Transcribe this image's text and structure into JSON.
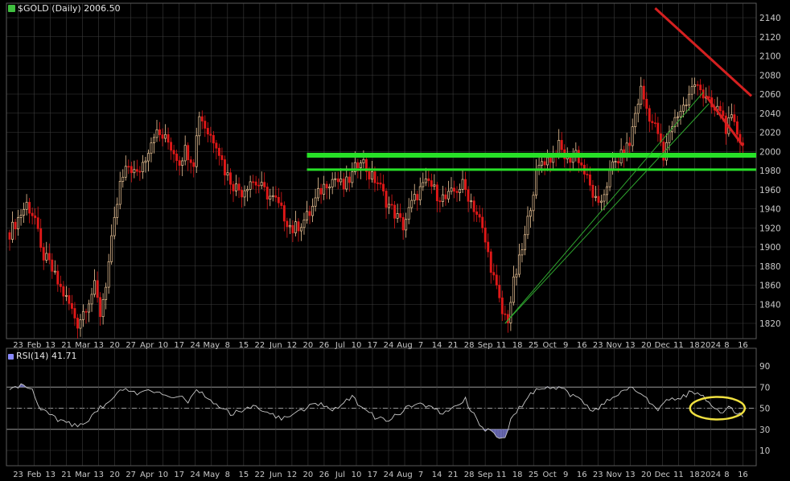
{
  "colors": {
    "background": "#000000",
    "grid": "#3c3c3c",
    "axis_text": "#c8c8c8",
    "candle_up": "#f0c89a",
    "candle_down": "#e01818",
    "support_line": "#27e027",
    "trendline": "#2fa82f",
    "resistance_line": "#d42020",
    "rsi_line": "#c8c8c8",
    "rsi_fill": "#8080d8",
    "highlight_ellipse": "#f0e040"
  },
  "price_panel": {
    "header_icon": "gold-chart-icon",
    "header": "$GOLD (Daily) 2006.50"
  },
  "rsi_panel": {
    "header_icon": "rsi-indicator-icon",
    "header": "RSI(14) 41.71"
  },
  "chart_data": [
    {
      "type": "candlestick",
      "title": "$GOLD (Daily) 2006.50",
      "ylim": [
        1805,
        2160
      ],
      "y_ticks": [
        1820,
        1840,
        1860,
        1880,
        1900,
        1920,
        1940,
        1960,
        1980,
        2000,
        2020,
        2040,
        2060,
        2080,
        2100,
        2120,
        2140
      ],
      "x_tick_labels": [
        "23",
        "Feb",
        "13",
        "21",
        "Mar",
        "13",
        "20",
        "27",
        "Apr",
        "10",
        "17",
        "24",
        "May",
        "8",
        "15",
        "22",
        "Jun",
        "12",
        "20",
        "26",
        "Jul",
        "10",
        "17",
        "24",
        "Aug",
        "7",
        "14",
        "21",
        "28",
        "Sep",
        "11",
        "18",
        "25",
        "Oct",
        "9",
        "16",
        "23",
        "Nov",
        "13",
        "20",
        "Dec",
        "11",
        "18",
        "2024",
        "8",
        "16"
      ],
      "grid": true,
      "price_path": [
        [
          0,
          1915
        ],
        [
          3,
          1930
        ],
        [
          6,
          1945
        ],
        [
          9,
          1930
        ],
        [
          11,
          1895
        ],
        [
          14,
          1882
        ],
        [
          17,
          1862
        ],
        [
          21,
          1840
        ],
        [
          24,
          1820
        ],
        [
          28,
          1845
        ],
        [
          30,
          1858
        ],
        [
          32,
          1830
        ],
        [
          34,
          1862
        ],
        [
          36,
          1905
        ],
        [
          39,
          1965
        ],
        [
          42,
          1985
        ],
        [
          45,
          1975
        ],
        [
          48,
          1995
        ],
        [
          51,
          2020
        ],
        [
          54,
          2015
        ],
        [
          56,
          2010
        ],
        [
          58,
          2000
        ],
        [
          60,
          1990
        ],
        [
          62,
          2002
        ],
        [
          65,
          1990
        ],
        [
          67,
          2040
        ],
        [
          70,
          2020
        ],
        [
          73,
          2010
        ],
        [
          76,
          1980
        ],
        [
          79,
          1965
        ],
        [
          82,
          1958
        ],
        [
          85,
          1970
        ],
        [
          88,
          1965
        ],
        [
          91,
          1955
        ],
        [
          94,
          1948
        ],
        [
          97,
          1932
        ],
        [
          100,
          1918
        ],
        [
          103,
          1925
        ],
        [
          106,
          1935
        ],
        [
          109,
          1955
        ],
        [
          112,
          1968
        ],
        [
          115,
          1972
        ],
        [
          118,
          1962
        ],
        [
          121,
          1975
        ],
        [
          124,
          1995
        ],
        [
          127,
          1975
        ],
        [
          130,
          1968
        ],
        [
          133,
          1948
        ],
        [
          136,
          1935
        ],
        [
          139,
          1922
        ],
        [
          142,
          1945
        ],
        [
          145,
          1960
        ],
        [
          148,
          1968
        ],
        [
          151,
          1955
        ],
        [
          154,
          1950
        ],
        [
          157,
          1958
        ],
        [
          160,
          1965
        ],
        [
          163,
          1948
        ],
        [
          166,
          1928
        ],
        [
          168,
          1905
        ],
        [
          170,
          1880
        ],
        [
          172,
          1855
        ],
        [
          174,
          1830
        ],
        [
          176,
          1825
        ],
        [
          178,
          1862
        ],
        [
          180,
          1885
        ],
        [
          182,
          1910
        ],
        [
          184,
          1945
        ],
        [
          186,
          1975
        ],
        [
          188,
          1990
        ],
        [
          191,
          1993
        ],
        [
          194,
          2005
        ],
        [
          197,
          1990
        ],
        [
          200,
          2000
        ],
        [
          203,
          1978
        ],
        [
          206,
          1955
        ],
        [
          208,
          1940
        ],
        [
          210,
          1958
        ],
        [
          213,
          1985
        ],
        [
          216,
          1995
        ],
        [
          219,
          2008
        ],
        [
          221,
          2040
        ],
        [
          223,
          2065
        ],
        [
          225,
          2045
        ],
        [
          227,
          2030
        ],
        [
          229,
          2020
        ],
        [
          231,
          1990
        ],
        [
          233,
          2022
        ],
        [
          236,
          2040
        ],
        [
          239,
          2050
        ],
        [
          241,
          2065
        ],
        [
          243,
          2075
        ],
        [
          245,
          2058
        ],
        [
          247,
          2050
        ],
        [
          249,
          2042
        ],
        [
          251,
          2045
        ],
        [
          253,
          2025
        ],
        [
          255,
          2032
        ],
        [
          257,
          2020
        ],
        [
          259,
          2006.5
        ]
      ],
      "annotations": [
        {
          "kind": "support",
          "value": 1996
        },
        {
          "kind": "support",
          "value": 1981
        },
        {
          "kind": "resistance_trendline",
          "from": [
            228,
            2150
          ],
          "to": [
            262,
            2058
          ]
        },
        {
          "kind": "resistance_trendline",
          "from": [
            246,
            2058
          ],
          "to": [
            259,
            2006
          ]
        },
        {
          "kind": "uptrend_line",
          "from": [
            175,
            1820
          ],
          "to": [
            245,
            2062
          ]
        },
        {
          "kind": "uptrend_line",
          "from": [
            175,
            1820
          ],
          "to": [
            247,
            2050
          ]
        }
      ]
    },
    {
      "type": "line",
      "title": "RSI(14) 41.71",
      "ylim": [
        0,
        100
      ],
      "y_ticks": [
        10,
        30,
        50,
        70,
        90
      ],
      "overbought": 70,
      "oversold": 30,
      "midline": 50,
      "grid": true,
      "rsi_path": [
        [
          0,
          70
        ],
        [
          4,
          72
        ],
        [
          8,
          68
        ],
        [
          10,
          52
        ],
        [
          13,
          45
        ],
        [
          16,
          40
        ],
        [
          20,
          38
        ],
        [
          24,
          32
        ],
        [
          28,
          40
        ],
        [
          31,
          48
        ],
        [
          34,
          55
        ],
        [
          37,
          62
        ],
        [
          40,
          68
        ],
        [
          44,
          64
        ],
        [
          48,
          68
        ],
        [
          52,
          66
        ],
        [
          56,
          60
        ],
        [
          60,
          63
        ],
        [
          63,
          55
        ],
        [
          66,
          68
        ],
        [
          70,
          58
        ],
        [
          74,
          52
        ],
        [
          78,
          45
        ],
        [
          82,
          48
        ],
        [
          86,
          52
        ],
        [
          90,
          46
        ],
        [
          94,
          42
        ],
        [
          98,
          40
        ],
        [
          102,
          47
        ],
        [
          106,
          52
        ],
        [
          110,
          54
        ],
        [
          114,
          48
        ],
        [
          118,
          56
        ],
        [
          121,
          62
        ],
        [
          125,
          48
        ],
        [
          129,
          42
        ],
        [
          133,
          38
        ],
        [
          137,
          44
        ],
        [
          141,
          52
        ],
        [
          145,
          55
        ],
        [
          149,
          50
        ],
        [
          153,
          46
        ],
        [
          157,
          52
        ],
        [
          161,
          58
        ],
        [
          164,
          44
        ],
        [
          167,
          32
        ],
        [
          170,
          27
        ],
        [
          173,
          22
        ],
        [
          175,
          20
        ],
        [
          177,
          38
        ],
        [
          180,
          50
        ],
        [
          183,
          60
        ],
        [
          186,
          68
        ],
        [
          190,
          70
        ],
        [
          194,
          70
        ],
        [
          198,
          63
        ],
        [
          202,
          58
        ],
        [
          206,
          46
        ],
        [
          209,
          52
        ],
        [
          213,
          60
        ],
        [
          217,
          66
        ],
        [
          220,
          72
        ],
        [
          223,
          62
        ],
        [
          226,
          56
        ],
        [
          229,
          48
        ],
        [
          232,
          56
        ],
        [
          236,
          60
        ],
        [
          240,
          64
        ],
        [
          243,
          66
        ],
        [
          246,
          58
        ],
        [
          249,
          50
        ],
        [
          252,
          47
        ],
        [
          255,
          51
        ],
        [
          257,
          45
        ],
        [
          259,
          41.71
        ]
      ],
      "highlight": {
        "kind": "ellipse",
        "around_value": 50
      }
    }
  ]
}
